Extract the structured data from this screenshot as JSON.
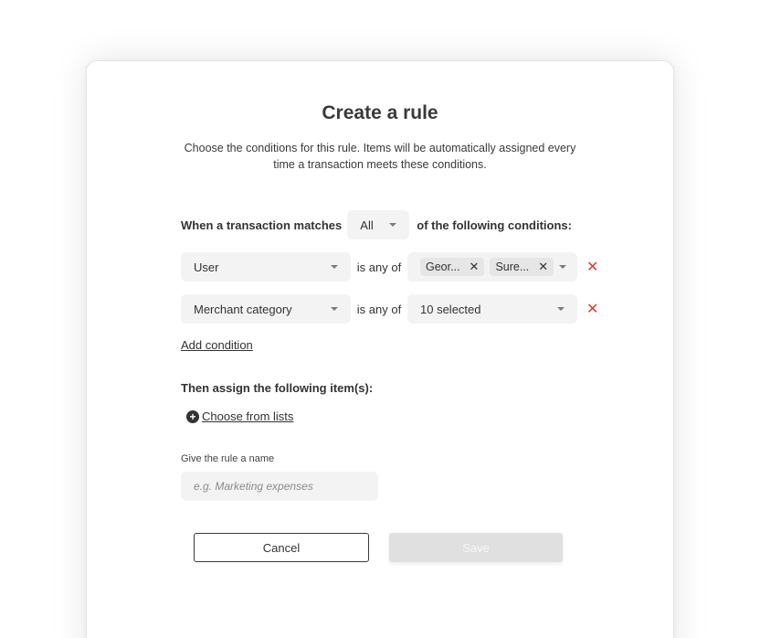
{
  "modal": {
    "title": "Create a rule",
    "subtitle": "Choose the conditions for this rule. Items will be automatically assigned every time a transaction meets these conditions."
  },
  "match": {
    "prefix": "When a transaction matches",
    "selected": "All",
    "suffix": "of the following conditions:"
  },
  "conditions": [
    {
      "field": "User",
      "operator": "is any of",
      "chips": [
        "Geor...",
        "Sure..."
      ],
      "value": ""
    },
    {
      "field": "Merchant category",
      "operator": "is any of",
      "chips": [],
      "value": "10 selected"
    }
  ],
  "add_condition_label": "Add condition",
  "assign": {
    "title": "Then assign the following item(s):",
    "choose_label": "Choose from lists"
  },
  "rule_name": {
    "label": "Give the rule a name",
    "placeholder": "e.g. Marketing expenses",
    "value": ""
  },
  "buttons": {
    "cancel": "Cancel",
    "save": "Save"
  },
  "colors": {
    "remove_accent": "#e03a2f",
    "field_background": "#f3f3f3",
    "save_disabled": "#e0e0e0"
  }
}
